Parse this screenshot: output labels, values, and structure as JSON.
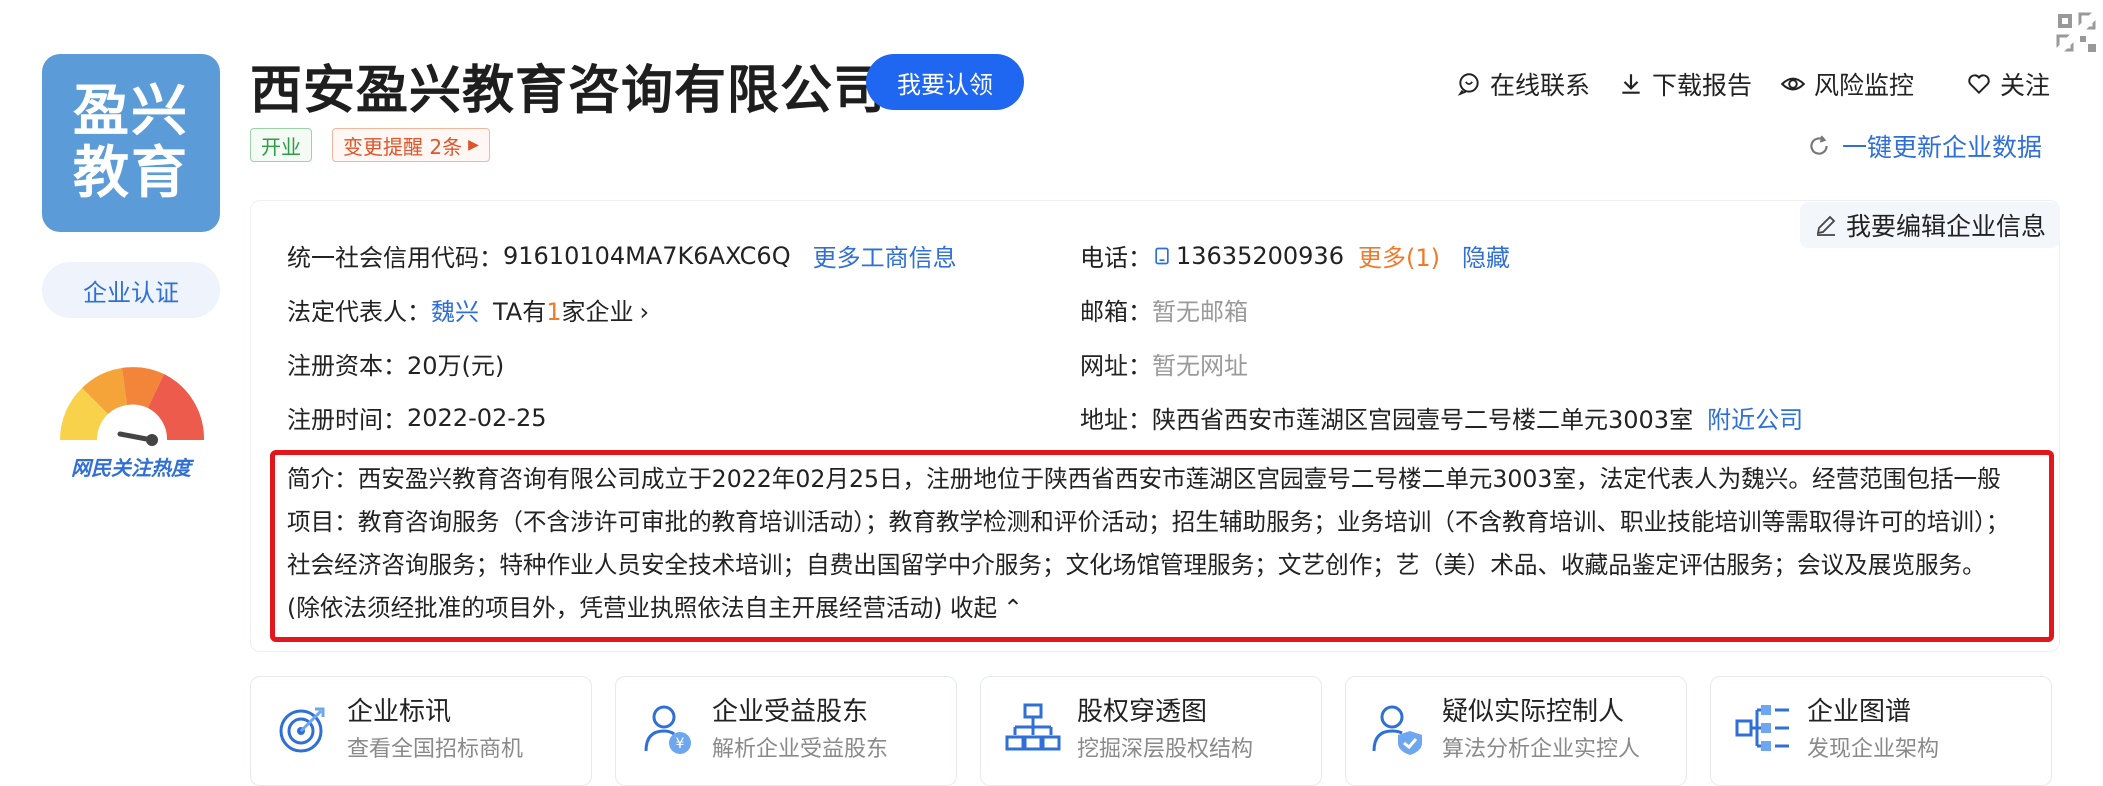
{
  "logo": {
    "line1": "盈兴",
    "line2": "教育"
  },
  "certification_label": "企业认证",
  "heat_label": "网民关注热度",
  "company_name": "西安盈兴教育咨询有限公司",
  "claim_button": "我要认领",
  "tags": {
    "status": "开业",
    "change_alert": "变更提醒 2条"
  },
  "actions": {
    "online_contact": "在线联系",
    "download_report": "下载报告",
    "risk_monitor": "风险监控",
    "follow": "关注",
    "refresh": "一键更新企业数据",
    "edit_info": "我要编辑企业信息"
  },
  "info": {
    "credit_code_label": "统一社会信用代码：",
    "credit_code": "91610104MA7K6AXC6Q",
    "more_business": "更多工商信息",
    "legal_rep_label": "法定代表人：",
    "legal_rep": "魏兴",
    "ta_prefix": "TA有",
    "ta_count": "1",
    "ta_suffix": "家企业",
    "capital_label": "注册资本：",
    "capital": "20万(元)",
    "reg_time_label": "注册时间：",
    "reg_time": "2022-02-25",
    "phone_label": "电话：",
    "phone": "13635200936",
    "phone_more": "更多(1)",
    "phone_hide": "隐藏",
    "email_label": "邮箱：",
    "email": "暂无邮箱",
    "website_label": "网址：",
    "website": "暂无网址",
    "address_label": "地址：",
    "address": "陕西省西安市莲湖区宫园壹号二号楼二单元3003室",
    "nearby": "附近公司"
  },
  "summary": {
    "text": "简介：西安盈兴教育咨询有限公司成立于2022年02月25日，注册地位于陕西省西安市莲湖区宫园壹号二号楼二单元3003室，法定代表人为魏兴。经营范围包括一般项目：教育咨询服务（不含涉许可审批的教育培训活动）；教育教学检测和评价活动；招生辅助服务；业务培训（不含教育培训、职业技能培训等需取得许可的培训）；社会经济咨询服务；特种作业人员安全技术培训；自费出国留学中介服务；文化场馆管理服务；文艺创作；艺（美）术品、收藏品鉴定评估服务；会议及展览服务。(除依法须经批准的项目外，凭营业执照依法自主开展经营活动)",
    "collapse": "收起"
  },
  "feature_cards": [
    {
      "title": "企业标讯",
      "sub": "查看全国招标商机",
      "icon": "target-icon"
    },
    {
      "title": "企业受益股东",
      "sub": "解析企业受益股东",
      "icon": "beneficiary-icon"
    },
    {
      "title": "股权穿透图",
      "sub": "挖掘深层股权结构",
      "icon": "org-chart-icon"
    },
    {
      "title": "疑似实际控制人",
      "sub": "算法分析企业实控人",
      "icon": "controller-shield-icon"
    },
    {
      "title": "企业图谱",
      "sub": "发现企业架构",
      "icon": "graph-icon"
    }
  ],
  "colors": {
    "brand_blue": "#1f66f0",
    "link_blue": "#2f6fd6",
    "highlight_red": "#e3161b",
    "accent_orange": "#f07a2a"
  }
}
